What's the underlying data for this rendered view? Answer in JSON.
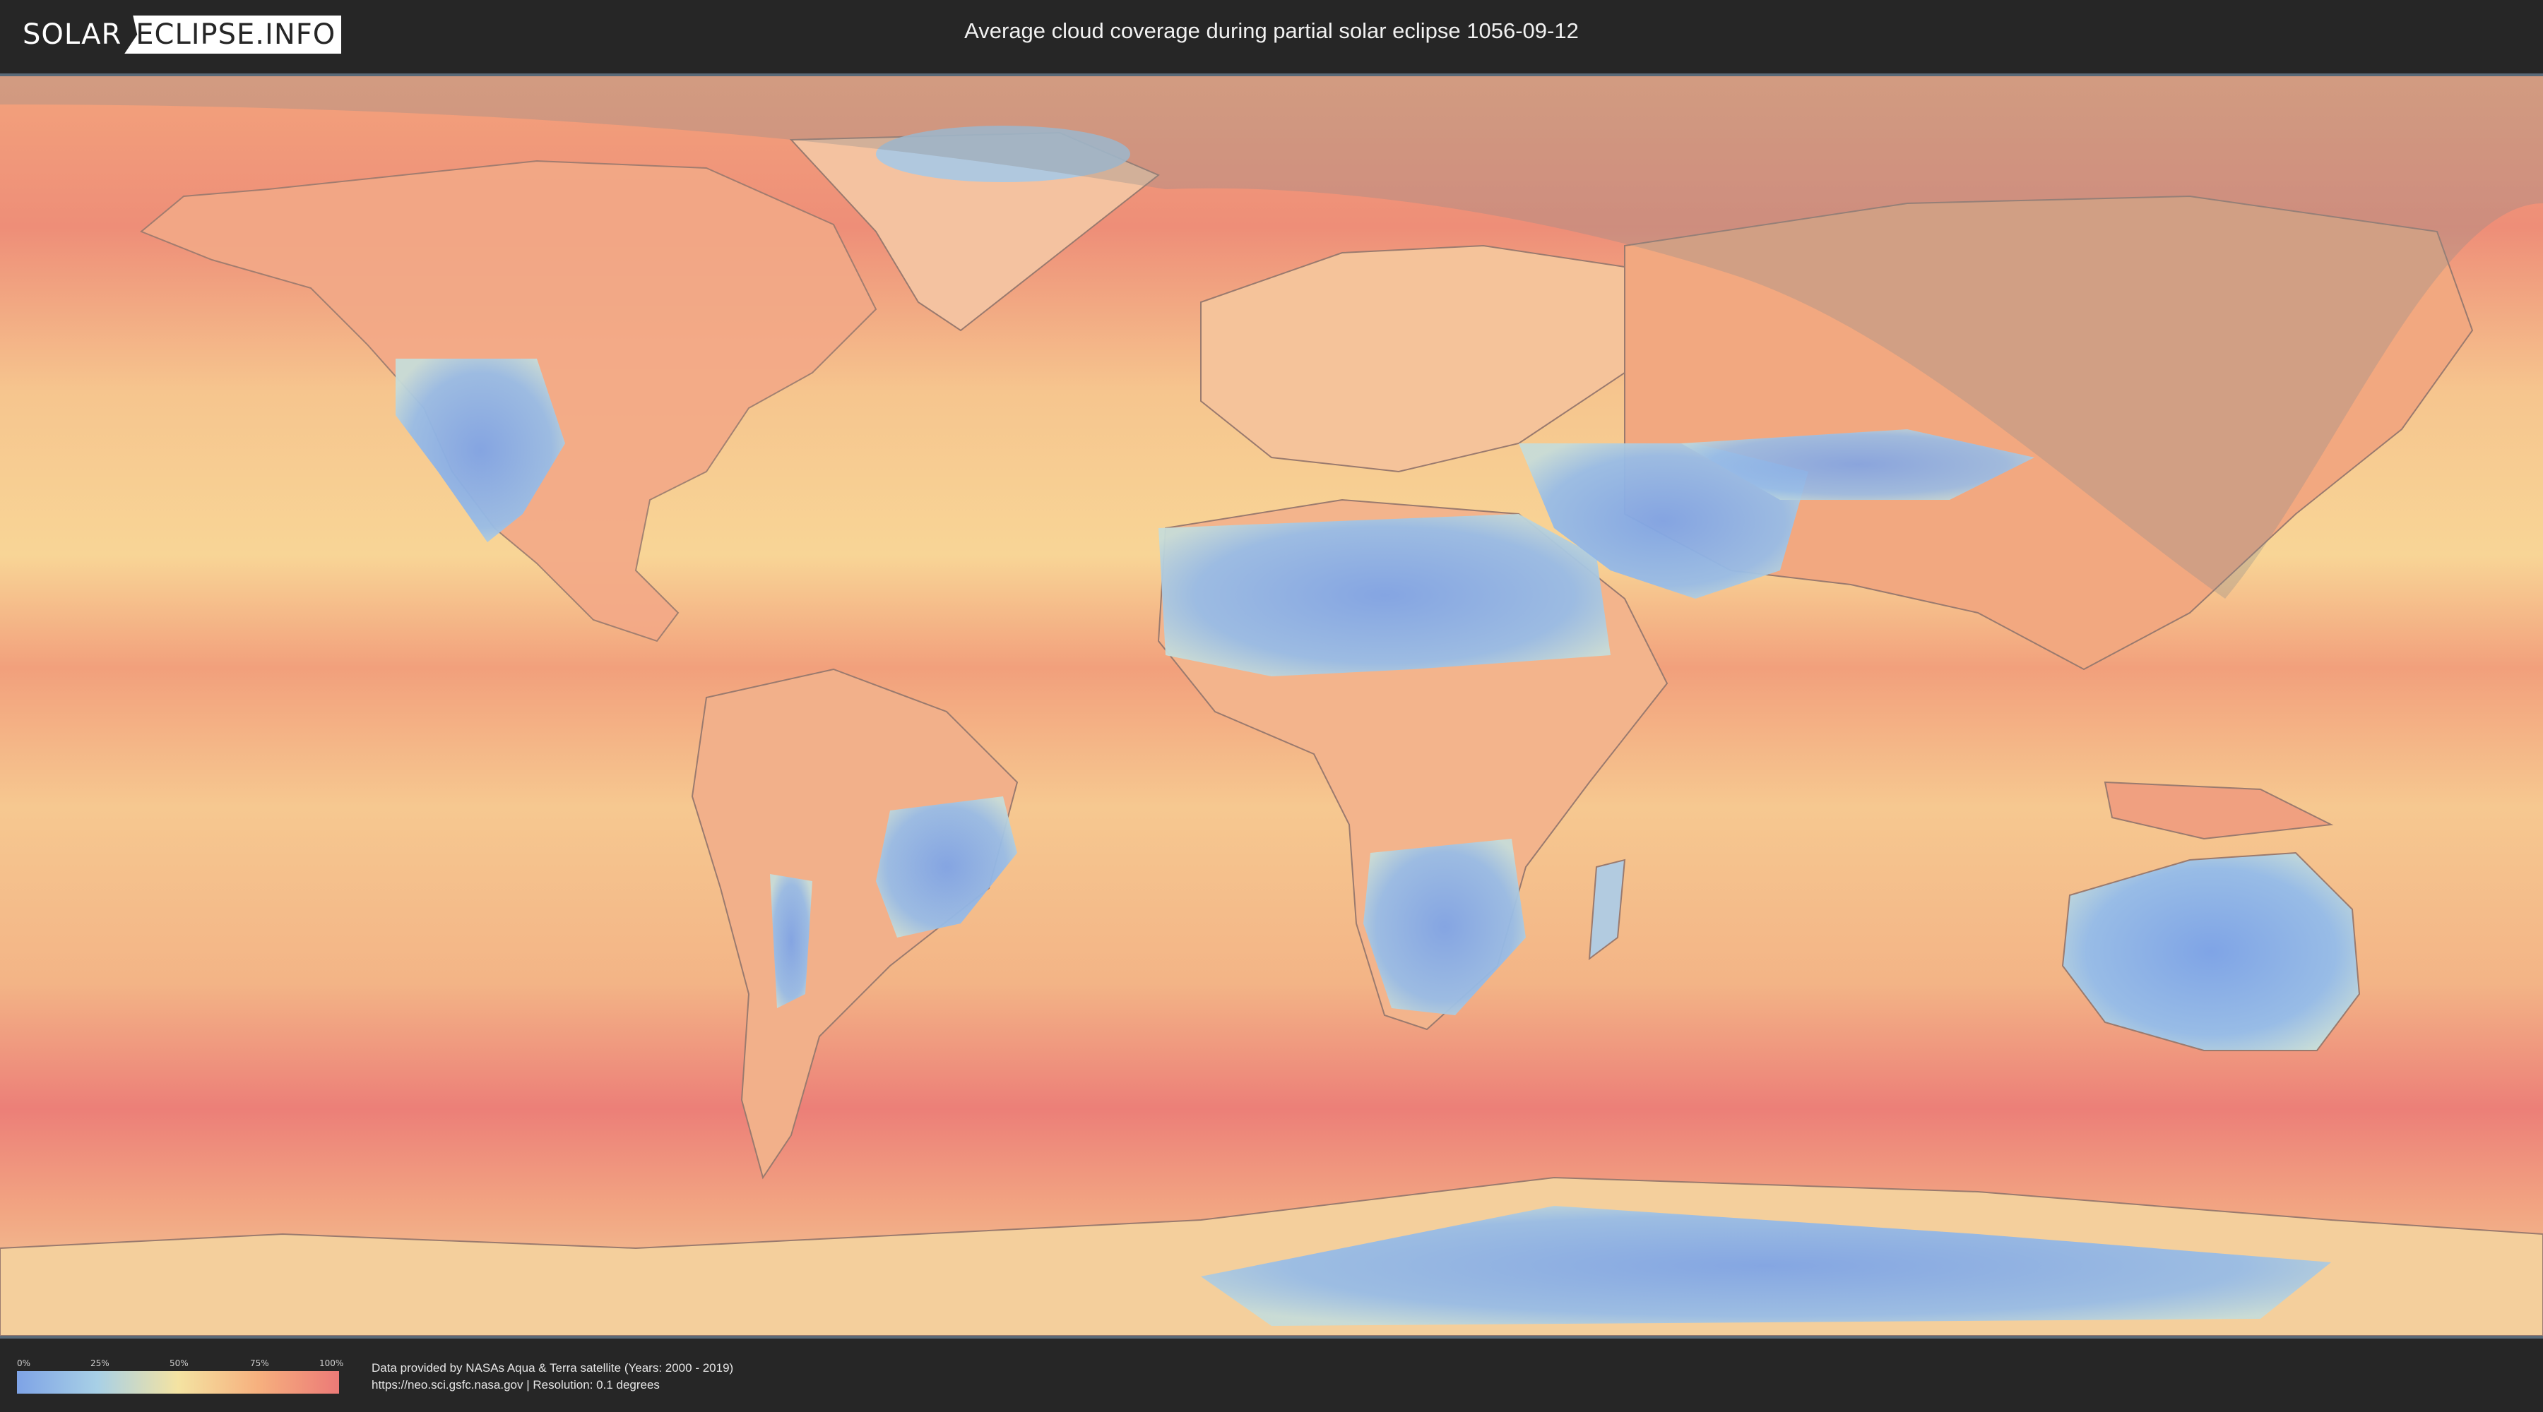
{
  "header": {
    "logo_left": "SOLAR",
    "logo_right": "ECLIPSE.INFO",
    "title": "Average cloud coverage during partial solar eclipse 1056-09-12"
  },
  "legend": {
    "ticks": [
      "0%",
      "25%",
      "50%",
      "75%",
      "100%"
    ],
    "colors": [
      "#7ea3e6",
      "#a8d0e6",
      "#f4e3a2",
      "#f6b07e",
      "#ec7a77"
    ]
  },
  "footer": {
    "credit_line1": "Data provided by NASAs Aqua & Terra satellite (Years: 2000 - 2019)",
    "credit_line2": "https://neo.sci.gsfc.nasa.gov | Resolution: 0.1 degrees"
  },
  "map": {
    "projection": "equirectangular world map",
    "eclipse_visibility_shading": "semi-transparent grey overlay over northern Atlantic, Europe, Russia and Asia",
    "colors": {
      "clear": "#7ea3e6",
      "ocean_mid": "#f6c58e",
      "cloudy": "#ec7a77"
    }
  }
}
